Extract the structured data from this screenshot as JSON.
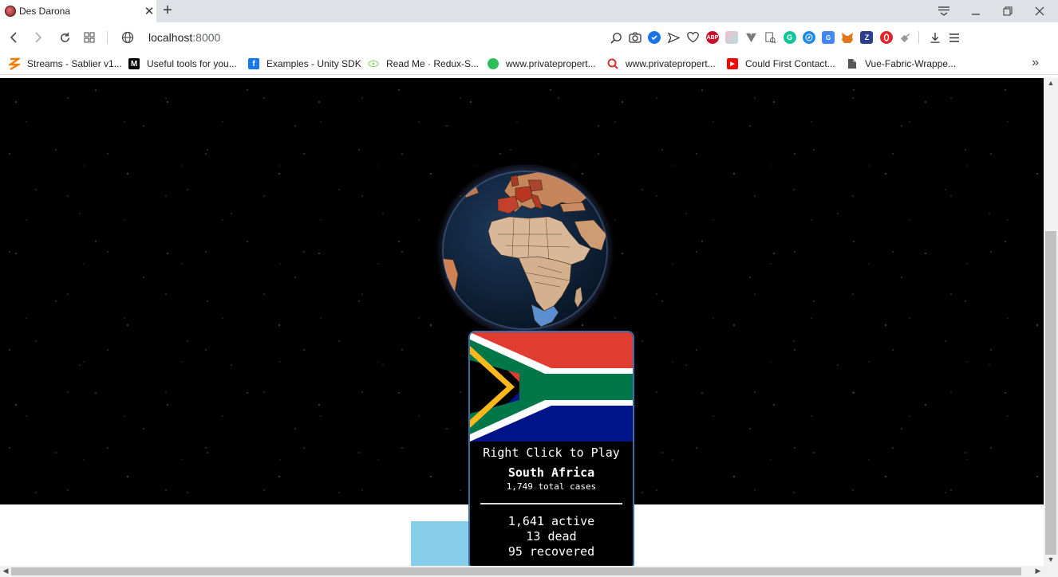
{
  "browser": {
    "tab": {
      "title": "Des Darona",
      "close_glyph": "✕",
      "favicon": "globe-favicon-icon"
    },
    "new_tab_glyph": "+",
    "window_controls": {
      "tabsearch": "⩸",
      "minimize": "—",
      "restore": "❐",
      "close": "✕"
    },
    "nav": {
      "back": "‹",
      "forward": "›",
      "reload": "↻",
      "tiles": "▦",
      "site_info": "🌐"
    },
    "url": {
      "host": "localhost",
      "port": ":8000"
    },
    "extensions": [
      "zoom-icon",
      "camera-icon",
      "shield-check-icon",
      "send-icon",
      "heart-icon",
      "adblock-plus-icon",
      "cube-icon",
      "vuetify-icon",
      "search-doc-icon",
      "grammarly-icon",
      "compass-icon",
      "translate-icon",
      "metamask-fox-icon",
      "zotero-icon",
      "opera-vpn-icon",
      "puzzle-icon",
      "download-icon",
      "menu-icon"
    ],
    "extension_labels": {
      "adblock": "ABP",
      "grammarly": "G",
      "zotero": "Z"
    },
    "bookmarks": [
      {
        "label": "Streams - Sablier v1...",
        "icon": "sablier-icon",
        "color": "#f57c00"
      },
      {
        "label": "Useful tools for you...",
        "icon": "medium-icon",
        "color": "#000000",
        "glyph": "M"
      },
      {
        "label": "Examples - Unity SDK",
        "icon": "facebook-icon",
        "color": "#1877f2",
        "glyph": "f"
      },
      {
        "label": "Read Me · Redux-S...",
        "icon": "redux-saga-icon",
        "color": "#86d46b"
      },
      {
        "label": "www.privatepropert...",
        "icon": "private-property-icon",
        "color": "#2ebd59"
      },
      {
        "label": "www.privatepropert...",
        "icon": "private-property-search-icon",
        "color": "#d32f2f"
      },
      {
        "label": "Could First Contact...",
        "icon": "youtube-icon",
        "color": "#ff0000",
        "glyph": "▶"
      },
      {
        "label": "Vue-Fabric-Wrappe...",
        "icon": "document-icon",
        "color": "#555555"
      }
    ],
    "bookmarks_more": "»"
  },
  "page": {
    "tooltip": {
      "action": "Right Click to Play",
      "country": "South Africa",
      "total": "1,749 total cases",
      "active": "1,641 active",
      "dead": "13 dead",
      "recovered": "95 recovered"
    },
    "colors": {
      "space": "#000000",
      "card_border": "#3a6ea5",
      "bottom_block": "#87ceeb"
    }
  },
  "scrollbars": {
    "up": "▲",
    "down": "▼",
    "left": "◀",
    "right": "▶"
  }
}
